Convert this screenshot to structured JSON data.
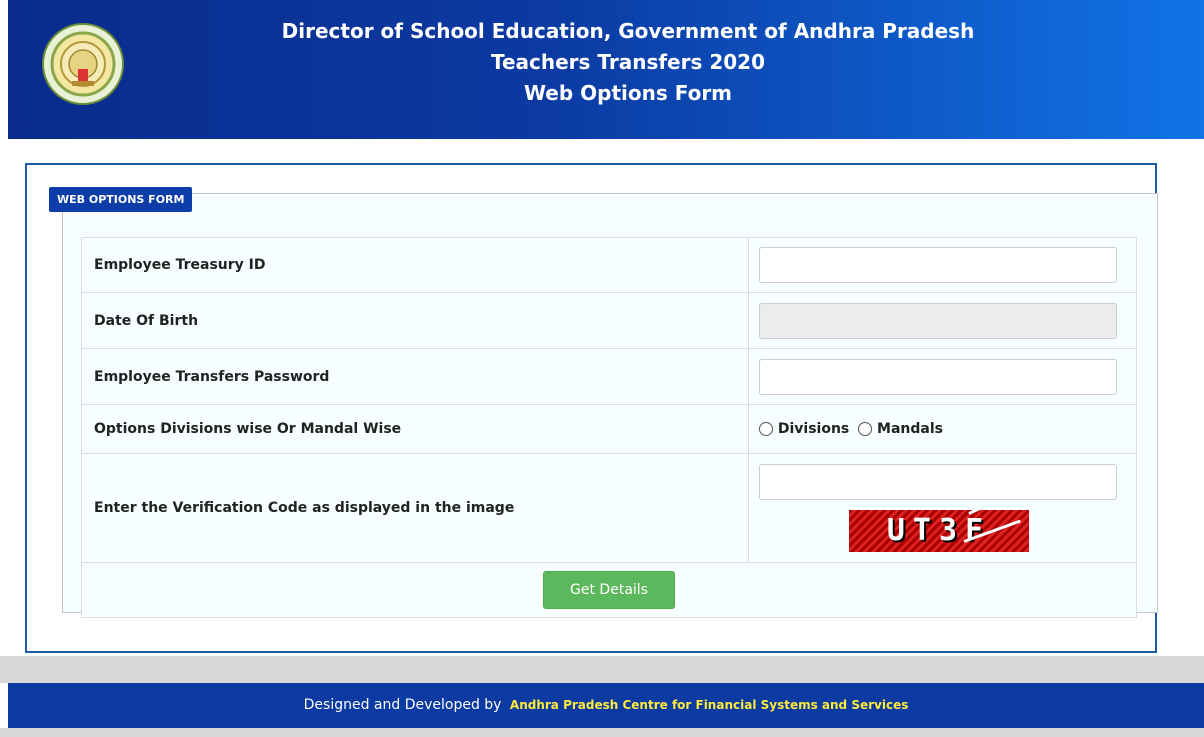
{
  "header": {
    "title_line1": "Director of School Education, Government of Andhra Pradesh",
    "title_line2": "Teachers Transfers 2020",
    "title_line3": "Web Options Form",
    "emblem_icon": "state-emblem-icon"
  },
  "form": {
    "legend": "WEB OPTIONS FORM",
    "rows": [
      {
        "label": "Employee Treasury ID",
        "value": "",
        "placeholder": ""
      },
      {
        "label": "Date Of Birth",
        "value": "",
        "placeholder": ""
      },
      {
        "label": "Employee Transfers Password",
        "value": "",
        "placeholder": ""
      },
      {
        "label": "Options Divisions wise Or Mandal Wise"
      },
      {
        "label": "Enter the Verification Code as displayed in the image",
        "value": "",
        "placeholder": ""
      }
    ],
    "radio_options": [
      "Divisions",
      "Mandals"
    ],
    "captcha_code": "UT3F",
    "submit_label": "Get Details"
  },
  "footer": {
    "prefix": "Designed and Developed by",
    "org": "Andhra Pradesh Centre for Financial Systems and Services"
  },
  "colors": {
    "header_dark": "#0a2b8c",
    "header_light": "#1173e6",
    "legend_bg": "#0c3da8",
    "button_green": "#5cb85c",
    "footer_bg": "#0b3aa2",
    "footer_org_text": "#ffeb3b"
  }
}
